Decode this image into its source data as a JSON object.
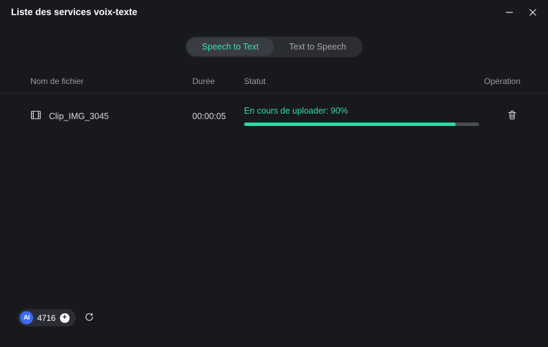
{
  "window": {
    "title": "Liste des services voix-texte"
  },
  "tabs": {
    "stt": "Speech to Text",
    "tts": "Text to Speech"
  },
  "headers": {
    "filename": "Nom de fichier",
    "duration": "Durée",
    "status": "Statut",
    "operation": "Opération"
  },
  "rows": [
    {
      "filename": "Clip_IMG_3045",
      "duration": "00:00:05",
      "status_text": "En cours de uploader:  90%",
      "progress_pct": 90
    }
  ],
  "footer": {
    "ai_label": "AI",
    "credits": "4716"
  }
}
